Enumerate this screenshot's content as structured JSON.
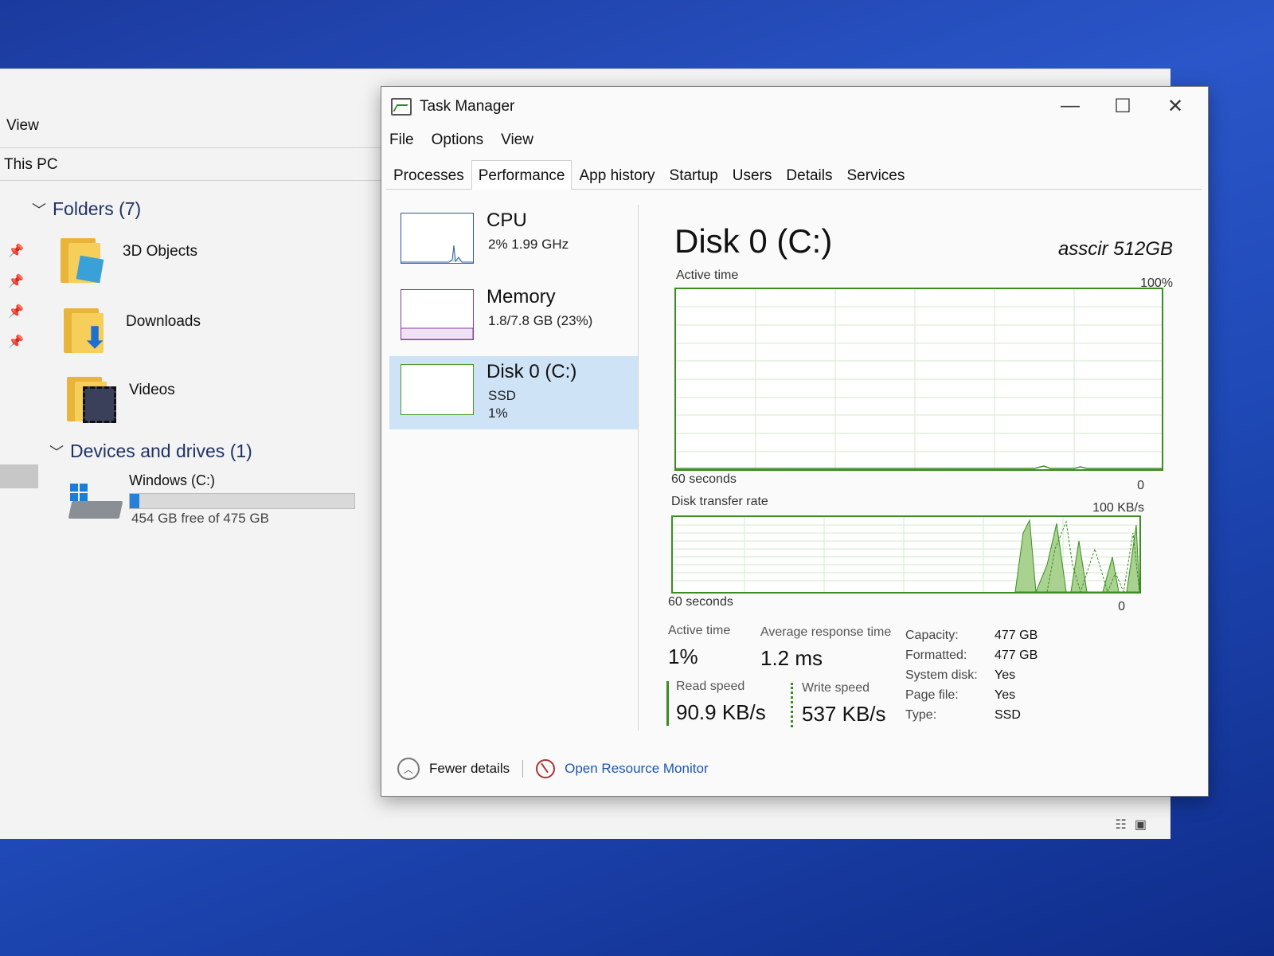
{
  "explorer": {
    "menu": "View",
    "address": "This PC",
    "folders_group": "Folders (7)",
    "folders": [
      {
        "label": "3D Objects",
        "icon": "3d-objects-folder-icon"
      },
      {
        "label": "Downloads",
        "icon": "downloads-folder-icon"
      },
      {
        "label": "Videos",
        "icon": "videos-folder-icon"
      }
    ],
    "devices_group": "Devices and drives (1)",
    "drive": {
      "name": "Windows (C:)",
      "free_text": "454 GB free of 475 GB",
      "used_fraction": 0.044
    }
  },
  "task_manager": {
    "title": "Task Manager",
    "menu": [
      "File",
      "Options",
      "View"
    ],
    "tabs": [
      "Processes",
      "Performance",
      "App history",
      "Startup",
      "Users",
      "Details",
      "Services"
    ],
    "active_tab": "Performance",
    "resources": [
      {
        "name": "CPU",
        "line1": "2% 1.99 GHz",
        "line2": ""
      },
      {
        "name": "Memory",
        "line1": "1.8/7.8 GB (23%)",
        "line2": ""
      },
      {
        "name": "Disk 0 (C:)",
        "line1": "SSD",
        "line2": "1%"
      }
    ],
    "selected_resource": "Disk 0 (C:)",
    "detail": {
      "title": "Disk 0 (C:)",
      "model": "asscir 512GB",
      "graph1": {
        "label": "Active time",
        "max": "100%",
        "xlabel": "60 seconds",
        "min": "0"
      },
      "graph2": {
        "label": "Disk transfer rate",
        "max": "100 KB/s",
        "xlabel": "60 seconds",
        "min": "0"
      },
      "stats": {
        "active_time_label": "Active time",
        "active_time": "1%",
        "avg_resp_label": "Average response time",
        "avg_resp": "1.2 ms",
        "read_label": "Read speed",
        "read": "90.9 KB/s",
        "write_label": "Write speed",
        "write": "537 KB/s"
      },
      "properties": [
        {
          "k": "Capacity:",
          "v": "477 GB"
        },
        {
          "k": "Formatted:",
          "v": "477 GB"
        },
        {
          "k": "System disk:",
          "v": "Yes"
        },
        {
          "k": "Page file:",
          "v": "Yes"
        },
        {
          "k": "Type:",
          "v": "SSD"
        }
      ]
    },
    "footer": {
      "fewer": "Fewer details",
      "resource_monitor": "Open Resource Monitor"
    }
  }
}
